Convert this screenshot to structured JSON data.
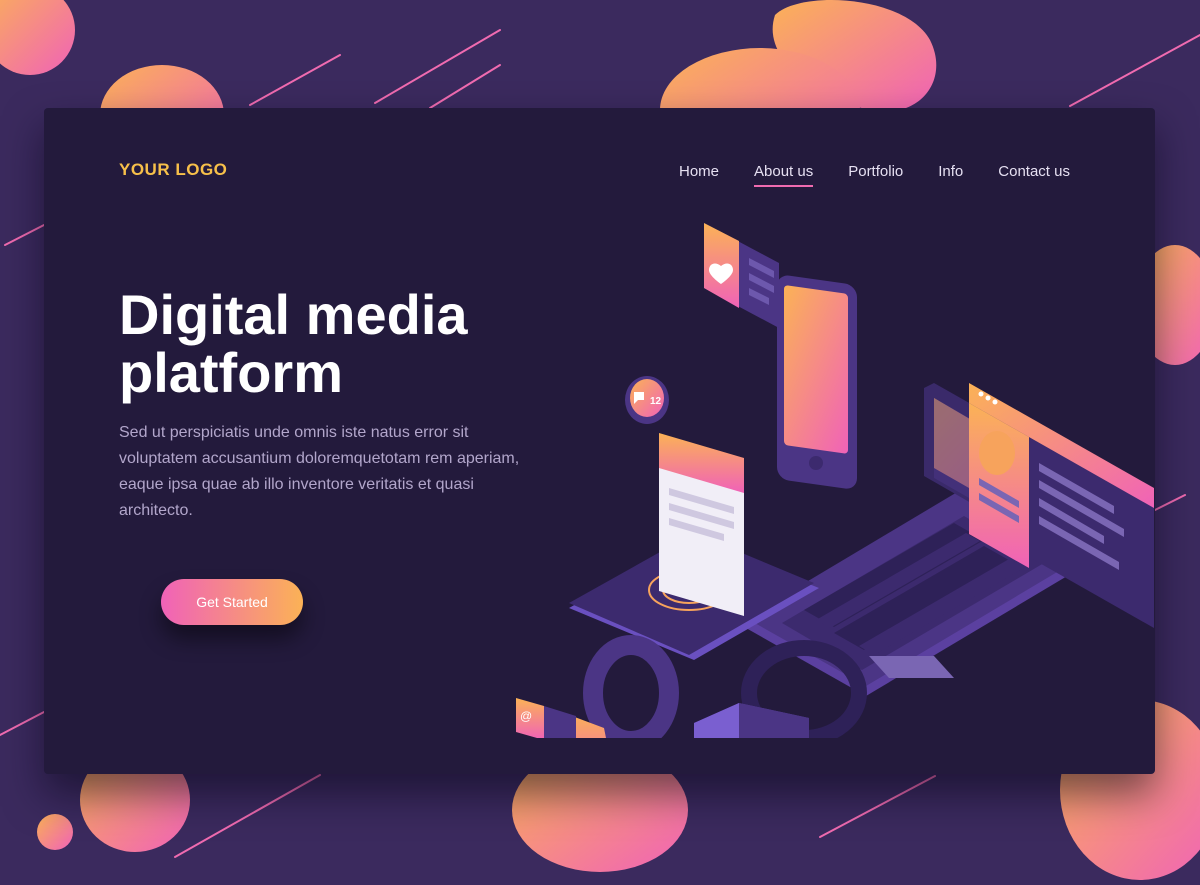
{
  "header": {
    "logo": "YOUR LOGO",
    "nav": [
      {
        "label": "Home"
      },
      {
        "label": "About us"
      },
      {
        "label": "Portfolio"
      },
      {
        "label": "Info"
      },
      {
        "label": "Contact us"
      }
    ],
    "active_nav": "About us"
  },
  "hero": {
    "title_line1": "Digital media",
    "title_line2": "platform",
    "description": "Sed ut perspiciatis unde omnis iste natus error sit voluptatem accusantium doloremquetotam rem aperiam, eaque ipsa quae ab illo inventore veritatis et quasi architecto.",
    "cta_label": "Get Started"
  },
  "illustration": {
    "notification_count": "12",
    "email_symbol": "@"
  },
  "colors": {
    "background": "#3b2a5e",
    "card": "#231a3c",
    "logo": "#f7c04a",
    "accent_pink": "#f062b8",
    "accent_orange": "#fbb256",
    "device_purple": "#4b3585"
  },
  "icons": [
    "heart-icon",
    "chat-bubble-icon",
    "email-at-icon",
    "target-icon",
    "browser-dots-icon"
  ]
}
